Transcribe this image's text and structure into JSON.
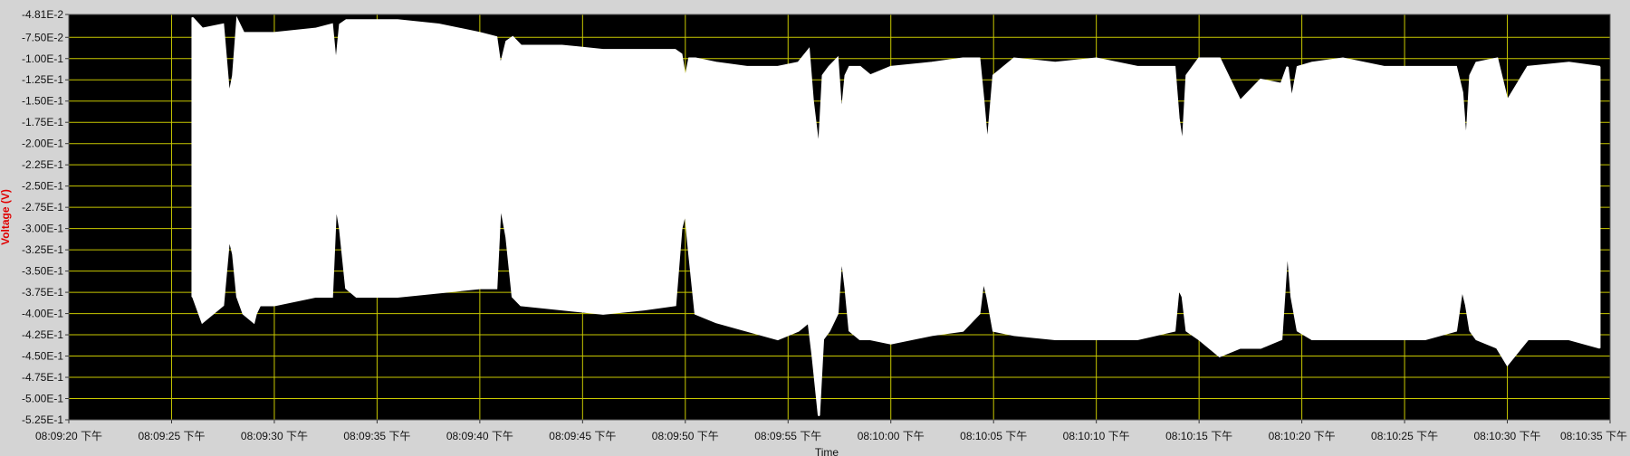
{
  "chart_data": {
    "type": "area",
    "xlabel": "Time",
    "ylabel": "Voltage (V)",
    "ylim": [
      -0.525,
      -0.0481
    ],
    "grid": true,
    "colors": {
      "plot_background": "#000000",
      "grid": "#c8c800",
      "signal": "#ffffff",
      "ylabel": "#e00000",
      "frame": "#d4d4d4"
    },
    "y_ticks": [
      {
        "value": -0.0481,
        "label": "-4.81E-2"
      },
      {
        "value": -0.075,
        "label": "-7.50E-2"
      },
      {
        "value": -0.1,
        "label": "-1.00E-1"
      },
      {
        "value": -0.125,
        "label": "-1.25E-1"
      },
      {
        "value": -0.15,
        "label": "-1.50E-1"
      },
      {
        "value": -0.175,
        "label": "-1.75E-1"
      },
      {
        "value": -0.2,
        "label": "-2.00E-1"
      },
      {
        "value": -0.225,
        "label": "-2.25E-1"
      },
      {
        "value": -0.25,
        "label": "-2.50E-1"
      },
      {
        "value": -0.275,
        "label": "-2.75E-1"
      },
      {
        "value": -0.3,
        "label": "-3.00E-1"
      },
      {
        "value": -0.325,
        "label": "-3.25E-1"
      },
      {
        "value": -0.35,
        "label": "-3.50E-1"
      },
      {
        "value": -0.375,
        "label": "-3.75E-1"
      },
      {
        "value": -0.4,
        "label": "-4.00E-1"
      },
      {
        "value": -0.425,
        "label": "-4.25E-1"
      },
      {
        "value": -0.45,
        "label": "-4.50E-1"
      },
      {
        "value": -0.475,
        "label": "-4.75E-1"
      },
      {
        "value": -0.5,
        "label": "-5.00E-1"
      },
      {
        "value": -0.525,
        "label": "-5.25E-1"
      }
    ],
    "x_ticks": [
      {
        "value": 0,
        "label": "08:09:20 下午"
      },
      {
        "value": 5,
        "label": "08:09:25 下午"
      },
      {
        "value": 10,
        "label": "08:09:30 下午"
      },
      {
        "value": 15,
        "label": "08:09:35 下午"
      },
      {
        "value": 20,
        "label": "08:09:40 下午"
      },
      {
        "value": 25,
        "label": "08:09:45 下午"
      },
      {
        "value": 30,
        "label": "08:09:50 下午"
      },
      {
        "value": 35,
        "label": "08:09:55 下午"
      },
      {
        "value": 40,
        "label": "08:10:00 下午"
      },
      {
        "value": 45,
        "label": "08:10:05 下午"
      },
      {
        "value": 50,
        "label": "08:10:10 下午"
      },
      {
        "value": 55,
        "label": "08:10:15 下午"
      },
      {
        "value": 60,
        "label": "08:10:20 下午"
      },
      {
        "value": 65,
        "label": "08:10:25 下午"
      },
      {
        "value": 70,
        "label": "08:10:30 下午"
      },
      {
        "value": 75,
        "label": "08:10:35 下午"
      }
    ],
    "xlim": [
      0,
      75
    ],
    "series": [
      {
        "style": "envelope",
        "t": [
          6.0,
          6.05,
          6.5,
          7.5,
          7.8,
          8.0,
          8.2,
          8.5,
          9.0,
          9.1,
          9.3,
          10.0,
          12.0,
          12.8,
          13.0,
          13.2,
          13.5,
          14.0,
          16.0,
          18.0,
          20.0,
          20.8,
          21.0,
          21.3,
          21.6,
          22.0,
          24.0,
          26.0,
          28.0,
          29.5,
          29.8,
          30.0,
          30.2,
          30.5,
          31.5,
          33.0,
          34.5,
          35.5,
          36.0,
          36.2,
          36.5,
          36.7,
          37.0,
          37.4,
          37.6,
          37.8,
          38.0,
          38.5,
          39.0,
          40.0,
          42.0,
          43.5,
          44.3,
          44.5,
          44.7,
          45.0,
          46.0,
          48.0,
          50.0,
          52.0,
          53.8,
          54.0,
          54.2,
          54.4,
          55.0,
          56.0,
          57.0,
          58.0,
          59.0,
          59.3,
          59.5,
          59.8,
          60.5,
          62.0,
          64.0,
          66.0,
          67.5,
          67.8,
          68.0,
          68.2,
          68.5,
          69.5,
          70.0,
          71.0,
          73.0,
          74.5
        ],
        "upper": [
          -0.052,
          -0.053,
          -0.065,
          -0.06,
          -0.145,
          -0.12,
          -0.055,
          -0.07,
          -0.07,
          -0.07,
          -0.07,
          -0.07,
          -0.065,
          -0.06,
          -0.11,
          -0.06,
          -0.055,
          -0.055,
          -0.055,
          -0.06,
          -0.07,
          -0.075,
          -0.11,
          -0.08,
          -0.075,
          -0.085,
          -0.085,
          -0.09,
          -0.09,
          -0.09,
          -0.095,
          -0.125,
          -0.1,
          -0.1,
          -0.105,
          -0.11,
          -0.11,
          -0.105,
          -0.09,
          -0.15,
          -0.21,
          -0.12,
          -0.11,
          -0.1,
          -0.17,
          -0.12,
          -0.11,
          -0.11,
          -0.12,
          -0.11,
          -0.105,
          -0.1,
          -0.1,
          -0.15,
          -0.205,
          -0.12,
          -0.1,
          -0.105,
          -0.1,
          -0.11,
          -0.11,
          -0.17,
          -0.205,
          -0.12,
          -0.1,
          -0.1,
          -0.15,
          -0.125,
          -0.13,
          -0.11,
          -0.15,
          -0.11,
          -0.105,
          -0.1,
          -0.11,
          -0.11,
          -0.11,
          -0.14,
          -0.205,
          -0.12,
          -0.105,
          -0.1,
          -0.15,
          -0.11,
          -0.105,
          -0.11
        ],
        "lower": [
          -0.38,
          -0.38,
          -0.41,
          -0.39,
          -0.31,
          -0.33,
          -0.38,
          -0.4,
          -0.41,
          -0.4,
          -0.39,
          -0.39,
          -0.38,
          -0.38,
          -0.27,
          -0.3,
          -0.37,
          -0.38,
          -0.38,
          -0.375,
          -0.37,
          -0.37,
          -0.27,
          -0.31,
          -0.38,
          -0.39,
          -0.395,
          -0.4,
          -0.395,
          -0.39,
          -0.3,
          -0.28,
          -0.33,
          -0.4,
          -0.41,
          -0.42,
          -0.43,
          -0.42,
          -0.41,
          -0.45,
          -0.52,
          -0.43,
          -0.42,
          -0.4,
          -0.33,
          -0.37,
          -0.42,
          -0.43,
          -0.43,
          -0.435,
          -0.425,
          -0.42,
          -0.4,
          -0.36,
          -0.38,
          -0.42,
          -0.425,
          -0.43,
          -0.43,
          -0.43,
          -0.42,
          -0.37,
          -0.38,
          -0.42,
          -0.43,
          -0.45,
          -0.44,
          -0.44,
          -0.43,
          -0.32,
          -0.38,
          -0.42,
          -0.43,
          -0.43,
          -0.43,
          -0.43,
          -0.42,
          -0.37,
          -0.39,
          -0.42,
          -0.43,
          -0.44,
          -0.46,
          -0.43,
          -0.43,
          -0.44
        ]
      }
    ]
  }
}
